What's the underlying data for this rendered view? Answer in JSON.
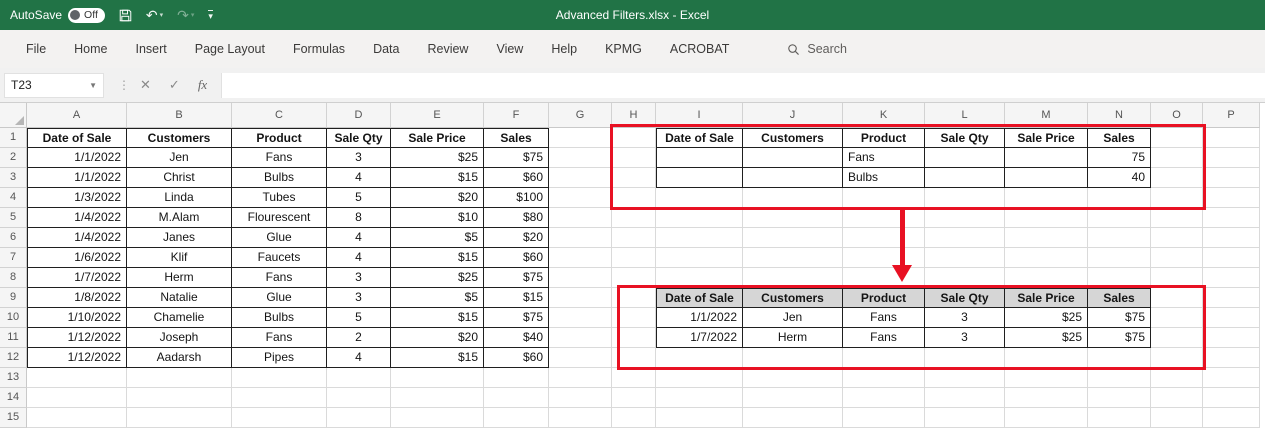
{
  "title_bar": {
    "autosave_label": "AutoSave",
    "autosave_state": "Off",
    "title": "Advanced Filters.xlsx - Excel"
  },
  "ribbon": {
    "tabs": [
      "File",
      "Home",
      "Insert",
      "Page Layout",
      "Formulas",
      "Data",
      "Review",
      "View",
      "Help",
      "KPMG",
      "ACROBAT"
    ],
    "search_label": "Search"
  },
  "formula_bar": {
    "name_box_value": "T23",
    "fx_label": "fx",
    "formula_value": ""
  },
  "sheet": {
    "column_letters": [
      "A",
      "B",
      "C",
      "D",
      "E",
      "F",
      "G",
      "H",
      "I",
      "J",
      "K",
      "L",
      "M",
      "N",
      "O",
      "P"
    ],
    "row_numbers": [
      "1",
      "2",
      "3",
      "4",
      "5",
      "6",
      "7",
      "8",
      "9",
      "10",
      "11",
      "12",
      "13",
      "14",
      "15"
    ]
  },
  "tables": {
    "main": {
      "anchor": "A1",
      "headers": [
        "Date of Sale",
        "Customers",
        "Product",
        "Sale Qty",
        "Sale Price",
        "Sales"
      ],
      "rows": [
        [
          "1/1/2022",
          "Jen",
          "Fans",
          "3",
          "$25",
          "$75"
        ],
        [
          "1/1/2022",
          "Christ",
          "Bulbs",
          "4",
          "$15",
          "$60"
        ],
        [
          "1/3/2022",
          "Linda",
          "Tubes",
          "5",
          "$20",
          "$100"
        ],
        [
          "1/4/2022",
          "M.Alam",
          "Flourescent",
          "8",
          "$10",
          "$80"
        ],
        [
          "1/4/2022",
          "Janes",
          "Glue",
          "4",
          "$5",
          "$20"
        ],
        [
          "1/6/2022",
          "Klif",
          "Faucets",
          "4",
          "$15",
          "$60"
        ],
        [
          "1/7/2022",
          "Herm",
          "Fans",
          "3",
          "$25",
          "$75"
        ],
        [
          "1/8/2022",
          "Natalie",
          "Glue",
          "3",
          "$5",
          "$15"
        ],
        [
          "1/10/2022",
          "Chamelie",
          "Bulbs",
          "5",
          "$15",
          "$75"
        ],
        [
          "1/12/2022",
          "Joseph",
          "Fans",
          "2",
          "$20",
          "$40"
        ],
        [
          "1/12/2022",
          "Aadarsh",
          "Pipes",
          "4",
          "$15",
          "$60"
        ]
      ]
    },
    "criteria": {
      "anchor": "I1",
      "headers": [
        "Date of Sale",
        "Customers",
        "Product",
        "Sale Qty",
        "Sale Price",
        "Sales"
      ],
      "rows": [
        [
          "",
          "",
          "Fans",
          "",
          "",
          "75"
        ],
        [
          "",
          "",
          "Bulbs",
          "",
          "",
          "40"
        ]
      ]
    },
    "filtered": {
      "anchor": "I9",
      "headers": [
        "Date of Sale",
        "Customers",
        "Product",
        "Sale Qty",
        "Sale Price",
        "Sales"
      ],
      "rows": [
        [
          "1/1/2022",
          "Jen",
          "Fans",
          "3",
          "$25",
          "$75"
        ],
        [
          "1/7/2022",
          "Herm",
          "Fans",
          "3",
          "$25",
          "$75"
        ]
      ]
    }
  },
  "annotations": {
    "highlight_color": "#e81123",
    "filtered_header_fill": "#d6d6d6",
    "table_border_color": "#1f1f1f"
  }
}
